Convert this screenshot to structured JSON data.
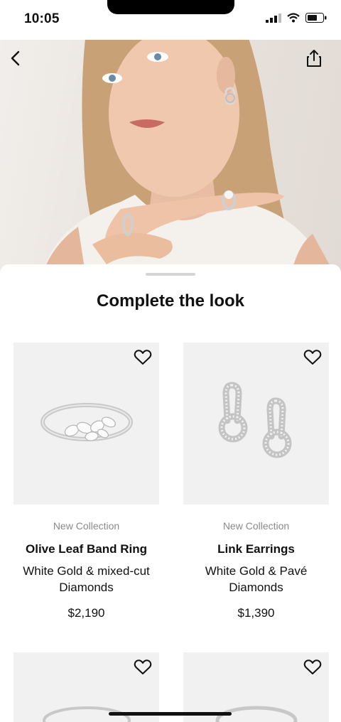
{
  "status_bar": {
    "time": "10:05"
  },
  "hero": {
    "back_icon": "chevron-left-icon",
    "share_icon": "share-icon"
  },
  "section": {
    "title": "Complete the look"
  },
  "products": [
    {
      "collection": "New Collection",
      "name": "Olive Leaf Band Ring",
      "material": "White Gold & mixed-cut Diamonds",
      "price": "$2,190",
      "icon": "heart-outline-icon"
    },
    {
      "collection": "New Collection",
      "name": "Link Earrings",
      "material": "White Gold & Pavé Diamonds",
      "price": "$1,390",
      "icon": "heart-outline-icon"
    }
  ],
  "colors": {
    "accent_text": "#111111",
    "muted_text": "#8a8a8a",
    "card_bg": "#f1f1f1"
  }
}
